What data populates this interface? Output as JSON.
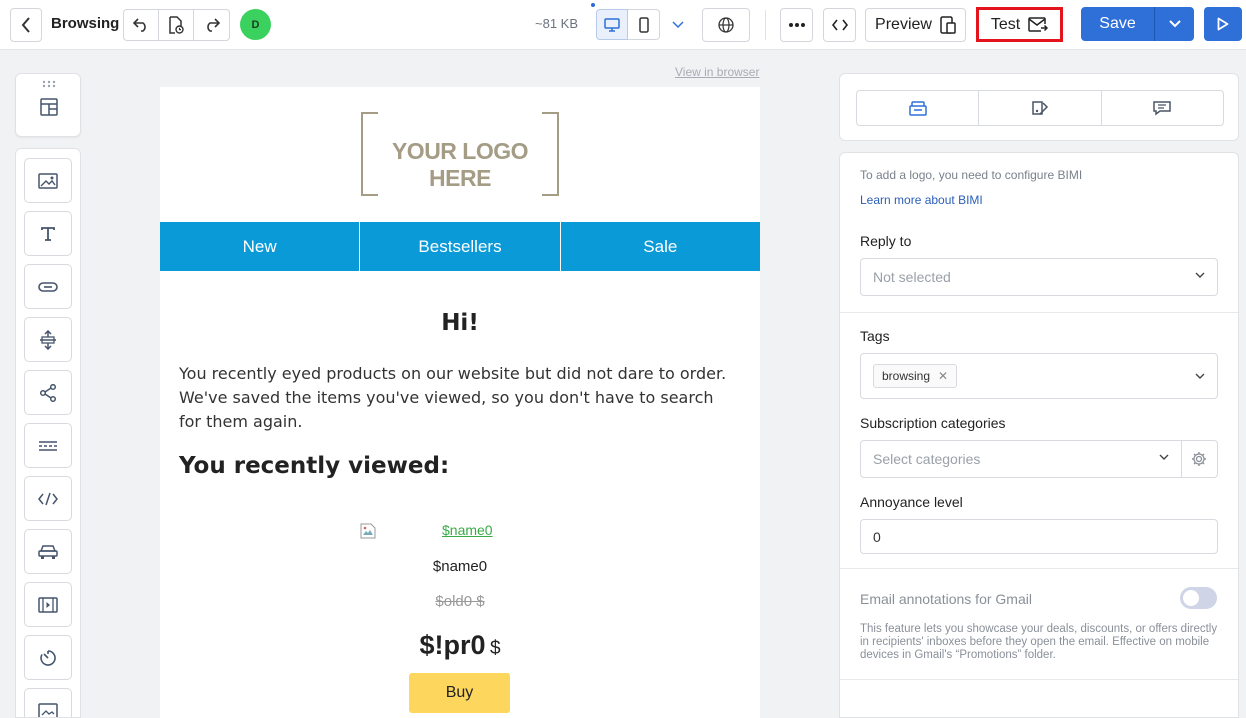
{
  "toolbar": {
    "title": "Browsing",
    "avatar_initial": "D",
    "size": "~81 KB",
    "preview_label": "Preview",
    "test_label": "Test",
    "save_label": "Save"
  },
  "email": {
    "view_in_browser": "View in browser",
    "logo_text": "YOUR LOGO HERE",
    "nav": [
      "New",
      "Bestsellers",
      "Sale"
    ],
    "greeting": "Hi!",
    "intro": "You recently eyed products on our website but did not dare to order. We've saved the items you've viewed, so you don't have to search for them again.",
    "recent_heading": "You recently viewed:",
    "product": {
      "image_alt": "$name0",
      "name": "$name0",
      "old_price": "$old0 $",
      "price": "$!pr0",
      "currency": "$",
      "buy_label": "Buy"
    }
  },
  "panel": {
    "bimi_note": "To add a logo, you need to configure BIMI",
    "bimi_link": "Learn more about BIMI",
    "reply_to_label": "Reply to",
    "reply_to_value": "Not selected",
    "tags_label": "Tags",
    "tag": "browsing",
    "subscription_label": "Subscription categories",
    "subscription_placeholder": "Select categories",
    "annoyance_label": "Annoyance level",
    "annoyance_value": "0",
    "gmail_label": "Email annotations for Gmail",
    "gmail_enabled": false,
    "gmail_desc": "This feature lets you showcase your deals, discounts, or offers directly in recipients' inboxes before they open the email. Effective on mobile devices in Gmail's “Promotions” folder."
  },
  "colors": {
    "accent": "#2f6fd8",
    "nav_bg": "#0a9ad8",
    "buy_bg": "#fdd65e",
    "highlight_border": "#e4141c"
  }
}
